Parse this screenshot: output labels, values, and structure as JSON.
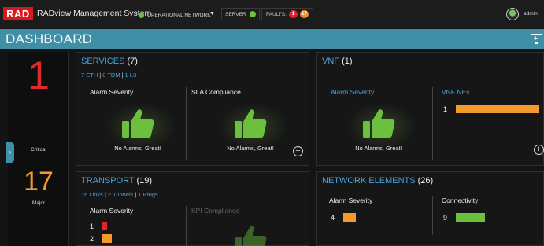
{
  "topbar": {
    "logo": "RAD",
    "app_title": "RADview Management System",
    "network_status": "OPERATIONAL NETWORK",
    "server_label": "SERVER",
    "faults_label": "FAULTS:",
    "faults_critical": "1",
    "faults_major": "17",
    "user": "admin"
  },
  "header": {
    "title": "DASHBOARD"
  },
  "summary": {
    "critical_count": "1",
    "critical_label": "Critical",
    "major_count": "17",
    "major_label": "Major"
  },
  "services": {
    "title": "SERVICES",
    "count": "(7)",
    "links": [
      "7 ETH",
      "0 TDM",
      "1 L3"
    ],
    "alarm_label": "Alarm Severity",
    "sla_label": "SLA Compliance",
    "alarm_msg": "No Alarms, Great!",
    "sla_msg": "No Alarms, Great!"
  },
  "vnf": {
    "title": "VNF",
    "count": "(1)",
    "alarm_label": "Alarm Severity",
    "nes_label": "VNF NEs",
    "alarm_msg": "No Alarms, Great!",
    "bar_value": "1"
  },
  "transport": {
    "title": "TRANSPORT",
    "count": "(19)",
    "links": [
      "16 Links",
      "2 Tunnels",
      "1 Rings"
    ],
    "alarm_label": "Alarm Severity",
    "kpi_label": "KPI Compliance",
    "rows": [
      {
        "value": "1",
        "color": "#e0252a"
      },
      {
        "value": "2",
        "color": "#f39a2a"
      }
    ]
  },
  "network_elements": {
    "title": "NETWORK ELEMENTS",
    "count": "(26)",
    "alarm_label": "Alarm Severity",
    "conn_label": "Connectivity",
    "alarm_value": "4",
    "alarm_color": "#f39a2a",
    "conn_value": "9",
    "conn_color": "#6dbf3e"
  },
  "colors": {
    "accent": "#3f8fa6",
    "link": "#4aa3d9",
    "critical": "#e0252a",
    "major": "#f39a2a",
    "ok": "#6dbf3e"
  }
}
